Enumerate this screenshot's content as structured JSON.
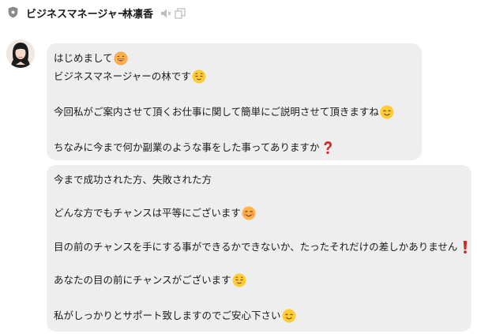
{
  "header": {
    "role": "ビジネスマネージャー",
    "name": "林凛香",
    "icons": [
      "shield-icon",
      "speaker-muted-icon",
      "copy-icon"
    ]
  },
  "messages": [
    {
      "lines": [
        {
          "text": "はじめまして",
          "emoji": "grinning-face"
        },
        {
          "text": "ビジネスマネージャーの林です",
          "emoji": "relieved-face"
        },
        {
          "text": "今回私がご案内させて頂くお仕事に関して簡単にご説明させて頂きますね",
          "emoji": "smiling-face"
        },
        {
          "text": "ちなみに今まで何か副業のような事をした事ってありますか",
          "emoji": "red-question-mark"
        }
      ]
    },
    {
      "lines": [
        {
          "text": "今まで成功された方、失敗された方",
          "emoji": ""
        },
        {
          "text": "どんな方でもチャンスは平等にございます",
          "emoji": "blushing-smile-face"
        },
        {
          "text": "目の前のチャンスを手にする事ができるかできないか、たったそれだけの差しかありません",
          "emoji": "red-exclamation-mark"
        },
        {
          "text": "あなたの目の前にチャンスがございます",
          "emoji": "relieved-face"
        },
        {
          "text": "私がしっかりとサポート致しますのでご安心下さい",
          "emoji": "smiling-face"
        }
      ]
    }
  ],
  "colors": {
    "bubble": "#eeeeee",
    "emoji_yellow": "#ffcc33",
    "emoji_red": "#d22a2a"
  }
}
